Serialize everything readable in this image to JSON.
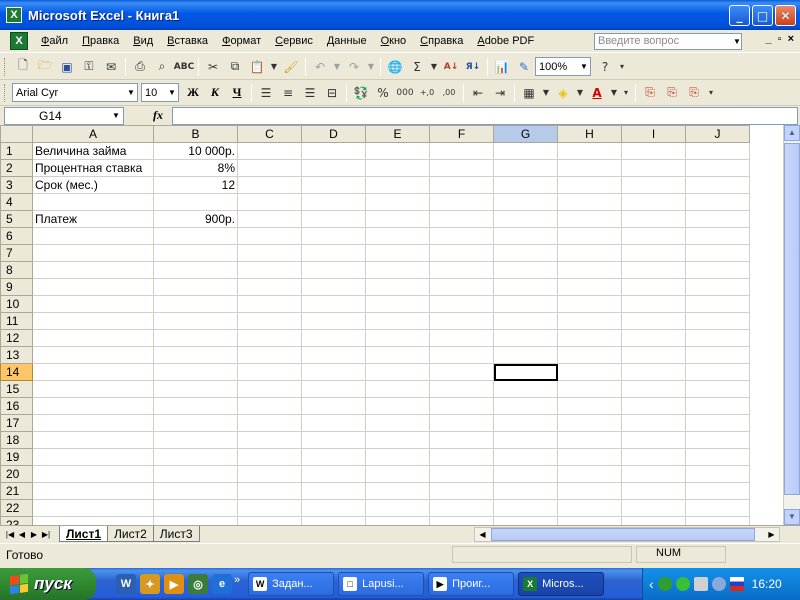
{
  "window": {
    "title": "Microsoft Excel - Книга1",
    "app_icon": "X",
    "controls": {
      "minimize": "_",
      "maximize": "□",
      "close": "✕"
    }
  },
  "menu": {
    "doc_icon": "X",
    "items": [
      "Файл",
      "Правка",
      "Вид",
      "Вставка",
      "Формат",
      "Сервис",
      "Данные",
      "Окно",
      "Справка",
      "Adobe PDF"
    ],
    "ask_placeholder": "Введите вопрос",
    "doc_controls": [
      "_",
      "▫",
      "×"
    ]
  },
  "toolbar": {
    "zoom": "100%",
    "font_name": "Arial Cyr",
    "font_size": "10",
    "bold": "Ж",
    "italic": "К",
    "underline": "Ч",
    "autosum": "Σ",
    "currency": "%",
    "thousands": "000",
    "increase_decimal": "+,0",
    "decrease_decimal": ",00"
  },
  "formula_bar": {
    "name_box": "G14",
    "fx": "fx",
    "value": ""
  },
  "sheet": {
    "columns": [
      "A",
      "B",
      "C",
      "D",
      "E",
      "F",
      "G",
      "H",
      "I",
      "J"
    ],
    "active_cell": "G14",
    "rows": [
      [
        "Величина займа",
        "10 000р."
      ],
      [
        "Процентная ставка",
        "8%"
      ],
      [
        "Срок (мес.)",
        "12"
      ],
      [
        "",
        ""
      ],
      [
        "Платеж",
        "900р."
      ],
      [
        "",
        ""
      ],
      [
        "",
        ""
      ],
      [
        "",
        ""
      ],
      [
        "",
        ""
      ],
      [
        "",
        ""
      ],
      [
        "",
        ""
      ],
      [
        "",
        ""
      ],
      [
        "",
        ""
      ],
      [
        "",
        ""
      ],
      [
        "",
        ""
      ],
      [
        "",
        ""
      ],
      [
        "",
        ""
      ],
      [
        "",
        ""
      ],
      [
        "",
        ""
      ],
      [
        "",
        ""
      ],
      [
        "",
        ""
      ],
      [
        "",
        ""
      ],
      [
        "",
        ""
      ]
    ],
    "tabs": [
      "Лист1",
      "Лист2",
      "Лист3"
    ],
    "active_tab": "Лист1"
  },
  "status": {
    "left": "Готово",
    "num": "NUM"
  },
  "taskbar": {
    "start_label": "пуск",
    "quick_more": "»",
    "buttons": [
      {
        "label": "Задан...",
        "icon": "W"
      },
      {
        "label": "Lapusi...",
        "icon": "□"
      },
      {
        "label": "Проиг...",
        "icon": "▶"
      },
      {
        "label": "Micros...",
        "icon": "X"
      }
    ],
    "tray_chevron": "‹",
    "clock": "16:20"
  }
}
